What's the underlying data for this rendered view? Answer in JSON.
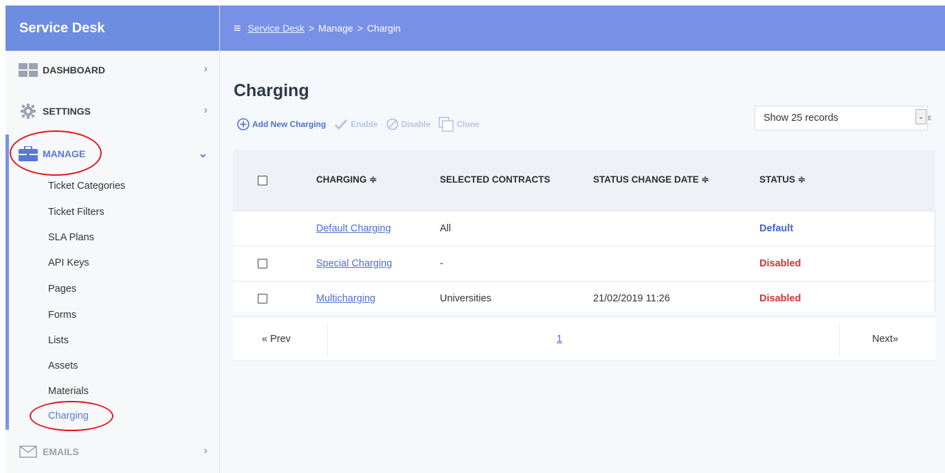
{
  "sidebar": {
    "brand": "Service Desk",
    "items": [
      {
        "label": "DASHBOARD",
        "chevron": "›"
      },
      {
        "label": "SETTINGS",
        "chevron": "›"
      },
      {
        "label": "MANAGE",
        "chevron": "⌄",
        "active": true
      },
      {
        "label": "EMAILS",
        "chevron": "›"
      }
    ],
    "manage_sub": [
      "Ticket Categories",
      "Ticket Filters",
      "SLA Plans",
      "API Keys",
      "Pages",
      "Forms",
      "Lists",
      "Assets",
      "Materials",
      "Charging"
    ]
  },
  "topbar": {
    "menu_icon": "≡",
    "crumb_root": "Service Desk",
    "crumb_sep1": ">",
    "crumb_mid": "Manage",
    "crumb_sep2": ">",
    "crumb_current": "Chargin"
  },
  "main": {
    "title": "Charging",
    "toolbar": {
      "add": "Add New Charging",
      "enable": "Enable",
      "disable": "Disable",
      "clone": "Clone"
    },
    "records_select": "Show 25 records",
    "records_cut": "ε"
  },
  "table": {
    "headers": [
      "CHARGING ≑",
      "SELECTED CONTRACTS",
      "STATUS CHANGE DATE ≑",
      "STATUS ≑"
    ],
    "rows": [
      {
        "name": "Default Charging",
        "contracts": "All",
        "date": "",
        "status": "Default"
      },
      {
        "name": "Special Charging",
        "contracts": "-",
        "date": "",
        "status": "Disabled"
      },
      {
        "name": "Multicharging",
        "contracts": "Universities",
        "date": "21/02/2019 11:26",
        "status": "Disabled"
      }
    ]
  },
  "pager": {
    "prev": "« Prev",
    "page": "1",
    "next": "Next»"
  },
  "colors": {
    "brand_blue": "#6f8de0",
    "topbar_blue": "#7891e6",
    "link_blue": "#4a6fd0",
    "status_default": "#3f63c9",
    "status_disabled": "#d03438",
    "annotation_red": "#e1161e"
  },
  "icons": {
    "dashboard": "grid-icon",
    "settings": "gear-icon",
    "manage": "briefcase-icon",
    "emails": "envelope-icon",
    "add": "plus-circle-icon",
    "enable": "checkmark-icon",
    "disable": "ban-icon",
    "clone": "clone-icon"
  }
}
